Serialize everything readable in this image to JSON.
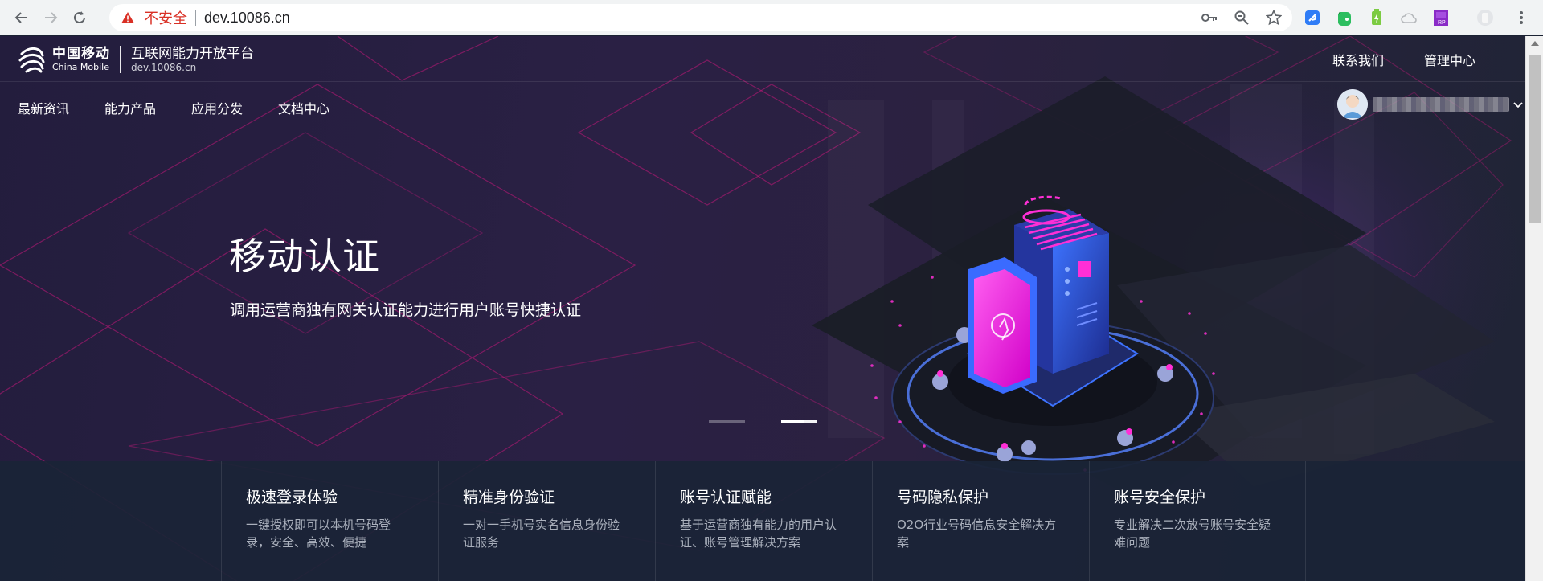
{
  "browser": {
    "security_label": "不安全",
    "url": "dev.10086.cn"
  },
  "site": {
    "logo": {
      "brand_cn": "中国移动",
      "brand_en": "China Mobile",
      "platform_name": "互联网能力开放平台",
      "domain": "dev.10086.cn"
    },
    "top_links": [
      "联系我们",
      "管理中心"
    ],
    "nav_items": [
      "最新资讯",
      "能力产品",
      "应用分发",
      "文档中心"
    ]
  },
  "hero": {
    "title": "移动认证",
    "subtitle": "调用运营商独有网关认证能力进行用户账号快捷认证",
    "slide_index": 2,
    "slide_count": 2
  },
  "features": [
    {
      "title": "极速登录体验",
      "desc": "一键授权即可以本机号码登录，安全、高效、便捷"
    },
    {
      "title": "精准身份验证",
      "desc": "一对一手机号实名信息身份验证服务"
    },
    {
      "title": "账号认证赋能",
      "desc": "基于运营商独有能力的用户认证、账号管理解决方案"
    },
    {
      "title": "号码隐私保护",
      "desc": "O2O行业号码信息安全解决方案"
    },
    {
      "title": "账号安全保护",
      "desc": "专业解决二次放号账号安全疑难问题"
    }
  ],
  "colors": {
    "accent_magenta": "#ff2fd6",
    "accent_blue": "#3a6bff",
    "warning_red": "#d93025"
  }
}
